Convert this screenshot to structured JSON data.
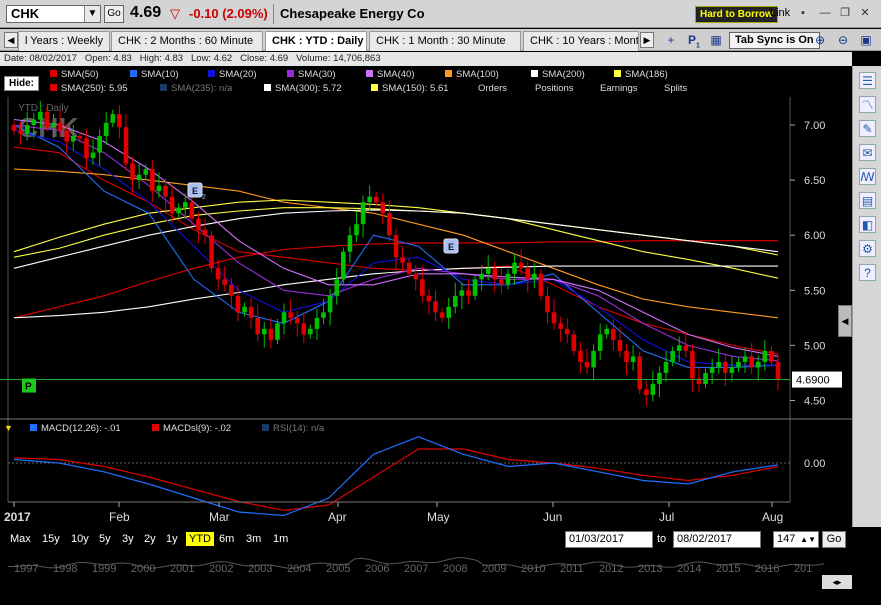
{
  "header": {
    "symbol": "CHK",
    "go_label": "Go",
    "last_price": "4.69",
    "change": "-0.10 (2.09%)",
    "company": "Chesapeake Energy Co",
    "hard_to_borrow": "Hard to Borrow",
    "link_label": "Link",
    "colors": {
      "up": "#00c000",
      "down": "#e00000"
    }
  },
  "tabs": [
    {
      "label": "l Years : Weekly",
      "active": false
    },
    {
      "label": "CHK : 2 Months : 60 Minute",
      "active": false
    },
    {
      "label": "CHK : YTD : Daily",
      "active": true
    },
    {
      "label": "CHK : 1 Month : 30 Minute",
      "active": false
    },
    {
      "label": "CHK : 10 Years : Month",
      "active": false
    }
  ],
  "tab_sync_label": "Tab Sync is On",
  "tab_badge": "1",
  "info": {
    "date": "Date: 08/02/2017",
    "open": "Open: 4.83",
    "high": "High: 4.83",
    "low": "Low: 4.62",
    "close": "Close: 4.69",
    "volume": "Volume: 14,706,863"
  },
  "hide_label": "Hide:",
  "legend_row1": [
    {
      "label": "SMA(50)",
      "color": "#e00000"
    },
    {
      "label": "SMA(10)",
      "color": "#1e6fff"
    },
    {
      "label": "SMA(20)",
      "color": "#1010dd"
    },
    {
      "label": "SMA(30)",
      "color": "#9a2cdd"
    },
    {
      "label": "SMA(40)",
      "color": "#d070ff"
    },
    {
      "label": "SMA(100)",
      "color": "#ff9a1e"
    },
    {
      "label": "SMA(200)",
      "color": "#ffffff"
    },
    {
      "label": "SMA(186)",
      "color": "#ffff40"
    }
  ],
  "legend_row2": [
    {
      "label": "SMA(250): 5.95",
      "color": "#e00000"
    },
    {
      "label": "SMA(235): n/a",
      "color": "#1a3a6a",
      "dim": true
    },
    {
      "label": "SMA(300): 5.72",
      "color": "#ffffff"
    },
    {
      "label": "SMA(150): 5.61",
      "color": "#ffff40"
    },
    {
      "label": "Orders"
    },
    {
      "label": "Positions"
    },
    {
      "label": "Earnings"
    },
    {
      "label": "Splits"
    }
  ],
  "chart_data": {
    "type": "candlestick",
    "watermark_symbol": "CHK",
    "watermark_period": "YTD : Daily",
    "y_ticks": [
      7.0,
      6.5,
      6.0,
      5.5,
      5.0,
      4.5
    ],
    "y_tick_labels": [
      "7.00",
      "6.50",
      "6.00",
      "5.50",
      "5.00",
      "4.50"
    ],
    "ylim": [
      4.35,
      7.2
    ],
    "x_labels": [
      "2017",
      "Feb",
      "Mar",
      "Apr",
      "May",
      "Jun",
      "Jul",
      "Aug"
    ],
    "last_value_label": "4.6900",
    "last_value": 4.69,
    "earnings_marker": "E",
    "earnings_marker_2_sub": "2",
    "position_marker": "P",
    "closes": [
      6.95,
      6.92,
      7.0,
      7.05,
      7.12,
      6.98,
      7.02,
      6.95,
      6.85,
      6.9,
      6.88,
      6.7,
      6.75,
      6.9,
      7.02,
      7.1,
      6.98,
      6.65,
      6.5,
      6.55,
      6.6,
      6.4,
      6.45,
      6.35,
      6.2,
      6.25,
      6.3,
      6.15,
      6.05,
      6.0,
      5.7,
      5.6,
      5.55,
      5.45,
      5.3,
      5.35,
      5.25,
      5.1,
      5.15,
      5.05,
      5.2,
      5.3,
      5.25,
      5.2,
      5.1,
      5.15,
      5.25,
      5.3,
      5.45,
      5.6,
      5.85,
      6.0,
      6.1,
      6.3,
      6.35,
      6.3,
      6.2,
      6.0,
      5.8,
      5.75,
      5.65,
      5.6,
      5.45,
      5.4,
      5.3,
      5.25,
      5.35,
      5.45,
      5.5,
      5.45,
      5.6,
      5.65,
      5.7,
      5.6,
      5.55,
      5.65,
      5.75,
      5.7,
      5.6,
      5.65,
      5.45,
      5.3,
      5.2,
      5.15,
      5.1,
      4.95,
      4.85,
      4.8,
      4.95,
      5.1,
      5.15,
      5.05,
      4.95,
      4.85,
      4.9,
      4.6,
      4.55,
      4.65,
      4.75,
      4.85,
      4.95,
      5.0,
      4.95,
      4.7,
      4.65,
      4.75,
      4.8,
      4.85,
      4.75,
      4.8,
      4.85,
      4.9,
      4.8,
      4.85,
      4.95,
      4.85,
      4.69
    ],
    "ma_lines": [
      {
        "name": "SMA(50)",
        "color": "#e00000",
        "values": [
          6.8,
          6.75,
          6.5,
          6.3,
          6.05,
          5.85,
          5.8,
          5.75,
          5.7,
          5.68,
          5.7,
          5.72,
          5.55,
          5.35,
          5.2,
          5.1,
          5.0,
          4.92
        ]
      },
      {
        "name": "SMA(250)",
        "color": "#e00000",
        "values": [
          5.25,
          5.35,
          5.45,
          5.58,
          5.7,
          5.8,
          5.87,
          5.9,
          5.92,
          5.93,
          5.93,
          5.93,
          5.94,
          5.94,
          5.95,
          5.95,
          5.95,
          5.95
        ]
      },
      {
        "name": "SMA(100)",
        "color": "#ff9a1e",
        "values": [
          6.6,
          6.58,
          6.55,
          6.5,
          6.45,
          6.4,
          6.3,
          6.25,
          6.2,
          6.1,
          6.0,
          5.85,
          5.7,
          5.55,
          5.42,
          5.35,
          5.3,
          5.25
        ]
      },
      {
        "name": "SMA(150)",
        "color": "#ffff40",
        "values": [
          5.85,
          5.98,
          6.1,
          6.2,
          6.25,
          6.3,
          6.32,
          6.3,
          6.28,
          6.25,
          6.2,
          6.15,
          6.05,
          5.95,
          5.85,
          5.78,
          5.7,
          5.61
        ]
      },
      {
        "name": "SMA(186)",
        "color": "#ffff40",
        "values": [
          5.8,
          5.88,
          6.0,
          6.1,
          6.18,
          6.22,
          6.25,
          6.25,
          6.24,
          6.22,
          6.2,
          6.15,
          6.1,
          6.05,
          6.0,
          5.95,
          5.9,
          5.82
        ]
      },
      {
        "name": "SMA(200)",
        "color": "#ffffff",
        "values": [
          5.7,
          5.8,
          5.9,
          6.0,
          6.08,
          6.15,
          6.2,
          6.22,
          6.23,
          6.22,
          6.2,
          6.15,
          6.1,
          6.05,
          6.0,
          5.95,
          5.9,
          5.85
        ]
      },
      {
        "name": "SMA(300)",
        "color": "#ffffff",
        "values": [
          5.25,
          5.27,
          5.3,
          5.35,
          5.42,
          5.48,
          5.55,
          5.6,
          5.65,
          5.68,
          5.7,
          5.71,
          5.72,
          5.72,
          5.72,
          5.72,
          5.72,
          5.72
        ]
      },
      {
        "name": "SMA(10)",
        "color": "#1e6fff",
        "values": [
          7.0,
          6.8,
          6.4,
          6.2,
          5.6,
          5.3,
          5.2,
          5.4,
          6.0,
          5.9,
          5.55,
          5.55,
          5.65,
          5.3,
          4.95,
          4.8,
          4.8,
          4.82
        ]
      },
      {
        "name": "SMA(20)",
        "color": "#1010dd",
        "values": [
          6.95,
          6.85,
          6.6,
          6.3,
          5.9,
          5.5,
          5.3,
          5.4,
          5.75,
          5.8,
          5.6,
          5.55,
          5.6,
          5.35,
          5.05,
          4.85,
          4.82,
          4.82
        ]
      },
      {
        "name": "SMA(30)",
        "color": "#9a2cdd",
        "values": [
          7.0,
          6.95,
          6.75,
          6.45,
          6.1,
          5.75,
          5.5,
          5.45,
          5.6,
          5.7,
          5.65,
          5.6,
          5.6,
          5.45,
          5.2,
          5.0,
          4.9,
          4.86
        ]
      },
      {
        "name": "SMA(40)",
        "color": "#d070ff",
        "values": [
          7.05,
          7.0,
          6.85,
          6.6,
          6.3,
          5.95,
          5.7,
          5.55,
          5.55,
          5.65,
          5.65,
          5.62,
          5.6,
          5.5,
          5.3,
          5.1,
          4.98,
          4.9
        ]
      }
    ],
    "indicator": {
      "macd_label": "MACD(12,26): -.01",
      "signal_label": "MACDsl(9): -.02",
      "rsi_label": "RSI(14): n/a",
      "zero_label": "0.00",
      "macd_color": "#1e6fff",
      "signal_color": "#e00000",
      "macd": [
        0.02,
        0.0,
        -0.05,
        -0.12,
        -0.2,
        -0.28,
        -0.3,
        -0.2,
        0.05,
        0.15,
        0.05,
        -0.02,
        0.0,
        -0.05,
        -0.1,
        -0.12,
        -0.05,
        -0.01
      ],
      "signal": [
        0.03,
        0.02,
        -0.02,
        -0.08,
        -0.15,
        -0.22,
        -0.27,
        -0.24,
        -0.08,
        0.08,
        0.08,
        0.02,
        0.0,
        -0.03,
        -0.07,
        -0.1,
        -0.07,
        -0.02
      ]
    }
  },
  "range_buttons": [
    "Max",
    "15y",
    "10y",
    "5y",
    "3y",
    "2y",
    "1y",
    "YTD",
    "6m",
    "3m",
    "1m"
  ],
  "range_selected": "YTD",
  "date_from": "01/03/2017",
  "date_to_label": "to",
  "date_to": "08/02/2017",
  "bars_count": "147",
  "go2_label": "Go",
  "nav_years": [
    "1997",
    "1998",
    "1999",
    "2000",
    "2001",
    "2002",
    "2003",
    "2004",
    "2005",
    "2006",
    "2007",
    "2008",
    "2009",
    "2010",
    "2011",
    "2012",
    "2013",
    "2014",
    "2015",
    "2016",
    "201"
  ]
}
